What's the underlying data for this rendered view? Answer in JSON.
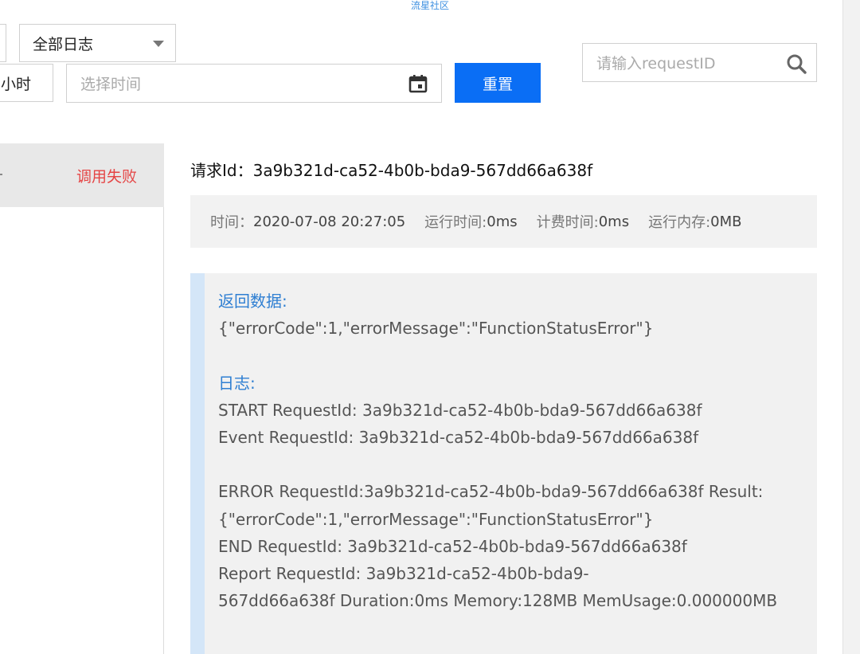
{
  "watermark": "流星社区",
  "filters": {
    "log_type": "全部日志",
    "hour_label": "小时",
    "time_placeholder": "选择时间",
    "reset_label": "重置",
    "search_placeholder": "请输入requestID"
  },
  "list": {
    "items": [
      {
        "status": "调用失败"
      }
    ]
  },
  "detail": {
    "request_label": "请求Id：",
    "request_id": "3a9b321d-ca52-4b0b-bda9-567dd66a638f",
    "meta": {
      "time_label": "时间：",
      "time_value": "2020-07-08 20:27:05",
      "run_time_label": "运行时间:",
      "run_time_value": "0ms",
      "billed_label": "计费时间:",
      "billed_value": "0ms",
      "memory_label": "运行内存:",
      "memory_value": "0MB"
    },
    "return_heading": "返回数据:",
    "return_data": "{\"errorCode\":1,\"errorMessage\":\"FunctionStatusError\"}",
    "log_heading": "日志:",
    "log_lines_a": [
      "START RequestId: 3a9b321d-ca52-4b0b-bda9-567dd66a638f",
      "Event RequestId: 3a9b321d-ca52-4b0b-bda9-567dd66a638f"
    ],
    "log_lines_b": [
      "ERROR RequestId:3a9b321d-ca52-4b0b-bda9-567dd66a638f Result:",
      "{\"errorCode\":1,\"errorMessage\":\"FunctionStatusError\"}",
      "END RequestId: 3a9b321d-ca52-4b0b-bda9-567dd66a638f",
      "Report RequestId: 3a9b321d-ca52-4b0b-bda9-",
      "567dd66a638f Duration:0ms Memory:128MB MemUsage:0.000000MB"
    ]
  },
  "icons": {
    "caret": "chevron-down-icon",
    "calendar": "calendar-icon",
    "search": "search-icon"
  },
  "colors": {
    "primary": "#0a6ef5",
    "error": "#e54545",
    "heading": "#2f7fd2"
  }
}
